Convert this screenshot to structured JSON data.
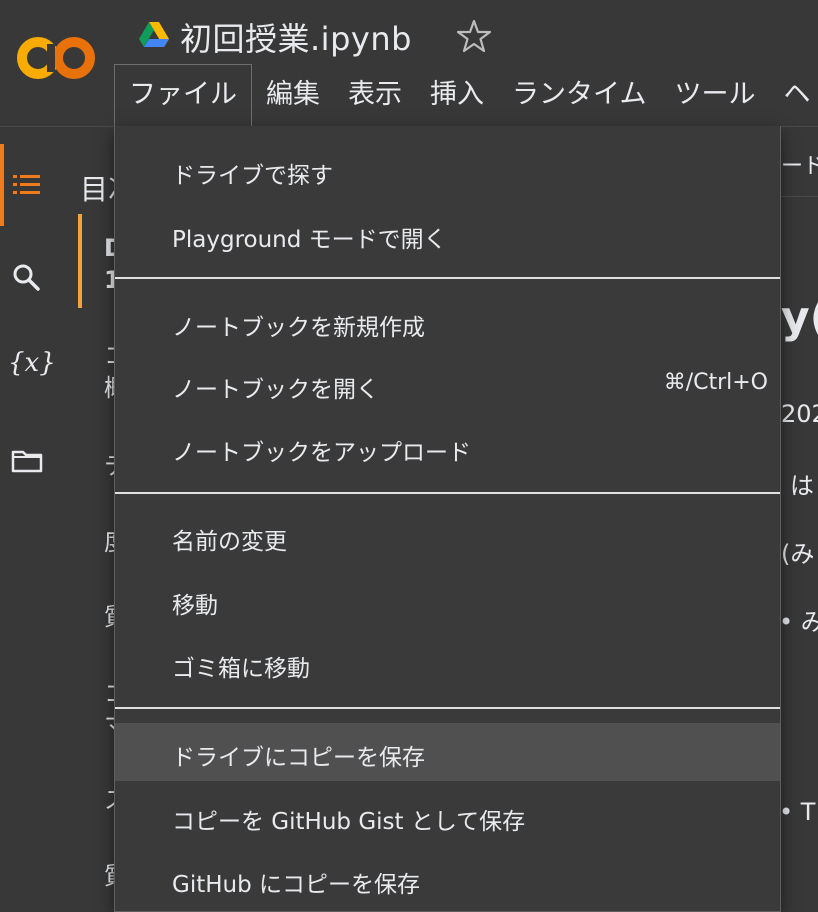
{
  "header": {
    "file_title": "初回授業.ipynb",
    "star_icon": "star-outline-icon"
  },
  "menubar": {
    "items": [
      {
        "label": "ファイル",
        "active": true
      },
      {
        "label": "編集"
      },
      {
        "label": "表示"
      },
      {
        "label": "挿入"
      },
      {
        "label": "ランタイム"
      },
      {
        "label": "ツール"
      },
      {
        "label": "ヘ"
      }
    ]
  },
  "sidebar": {
    "icons": [
      "toc-list-icon",
      "search-icon",
      "variables-icon",
      "folder-icon"
    ],
    "variables_glyph": "{x}"
  },
  "toc": {
    "title_fragment": "目次",
    "selected_fragment_line1": "D",
    "selected_fragment_line2": "1",
    "fragments": [
      "コ",
      "概",
      "テ",
      "度",
      "質",
      "コ",
      "マ",
      "ス",
      "質"
    ]
  },
  "right_fragments": {
    "tab": "ード",
    "heading": "y(",
    "date": "202",
    "line1": "は",
    "line2": "(み",
    "bullet1": "• み",
    "bullet2": "• T"
  },
  "file_menu": {
    "groups": [
      [
        {
          "label": "ドライブで探す"
        },
        {
          "label": "Playground モードで開く"
        }
      ],
      [
        {
          "label": "ノートブックを新規作成"
        },
        {
          "label": "ノートブックを開く",
          "shortcut": "⌘/Ctrl+O"
        },
        {
          "label": "ノートブックをアップロード"
        }
      ],
      [
        {
          "label": "名前の変更"
        },
        {
          "label": "移動"
        },
        {
          "label": "ゴミ箱に移動"
        }
      ],
      [
        {
          "label": "ドライブにコピーを保存",
          "hovered": true
        },
        {
          "label": "コピーを GitHub Gist として保存"
        },
        {
          "label": "GitHub にコピーを保存"
        }
      ]
    ]
  },
  "colors": {
    "background": "#383838",
    "menu_background": "#3a3a3a",
    "hover": "#505050",
    "accent_orange": "#ef7b1b",
    "accent_yellow": "#f2a33c",
    "text": "#e8eaed"
  }
}
